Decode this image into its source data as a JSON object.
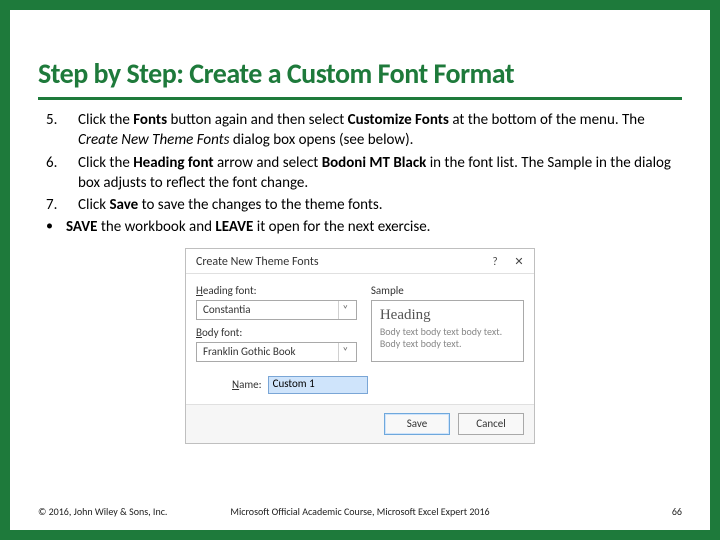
{
  "title": "Step by Step: Create a Custom Font Format",
  "steps": [
    {
      "num": "5.",
      "parts": [
        "Click the ",
        "Fonts",
        " button again and then select ",
        "Customize Fonts",
        " at the bottom of the menu. The ",
        "Create New Theme Fonts",
        " dialog box opens (see below)."
      ]
    },
    {
      "num": "6.",
      "parts": [
        "Click the ",
        "Heading font",
        " arrow and select ",
        "Bodoni MT Black",
        " in the font list. The Sample in the dialog box adjusts to reflect the font change."
      ]
    },
    {
      "num": "7.",
      "parts": [
        "Click ",
        "Save",
        " to save the changes to the theme fonts."
      ]
    },
    {
      "num": "•",
      "parts": [
        "SAVE",
        " the workbook and ",
        "LEAVE",
        " it open for the next exercise."
      ]
    }
  ],
  "dialog": {
    "title": "Create New Theme Fonts",
    "help_icon": "?",
    "close_icon": "✕",
    "heading_label_pre": "H",
    "heading_label_rest": "eading font:",
    "heading_value": "Constantia",
    "body_label_pre": "B",
    "body_label_rest": "ody font:",
    "body_value": "Franklin Gothic Book",
    "sample_label": "Sample",
    "sample_heading": "Heading",
    "sample_body": "Body text body text body text. Body text body text.",
    "name_label_pre": "N",
    "name_label_rest": "ame:",
    "name_value": "Custom 1",
    "save_label": "Save",
    "cancel_label": "Cancel",
    "caret": "˅"
  },
  "footer": {
    "left": "© 2016, John Wiley & Sons, Inc.",
    "center": "Microsoft Official Academic Course, Microsoft Excel Expert 2016",
    "right": "66"
  }
}
